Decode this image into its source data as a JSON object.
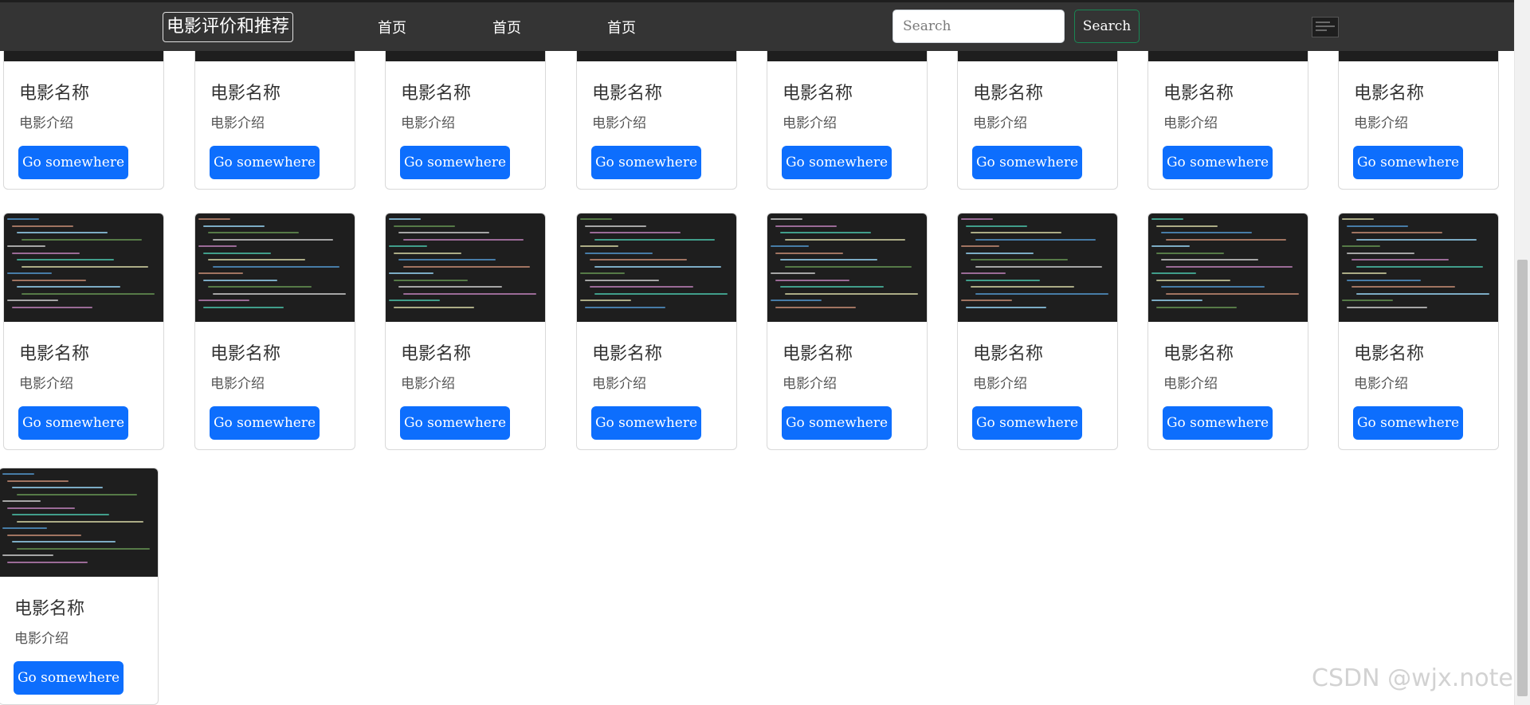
{
  "navbar": {
    "brand": "电影评价和推荐",
    "links": [
      "首页",
      "首页",
      "首页"
    ],
    "search_placeholder": "Search",
    "search_button": "Search"
  },
  "card": {
    "title": "电影名称",
    "text": "电影介绍",
    "button": "Go somewhere"
  },
  "cards_visible": 17,
  "watermark": "CSDN @wjx.note",
  "colors": {
    "navbar": "#343434",
    "primary_button": "#0d6efd",
    "search_button_border": "#198754",
    "card_image": "#1e1e1e"
  }
}
